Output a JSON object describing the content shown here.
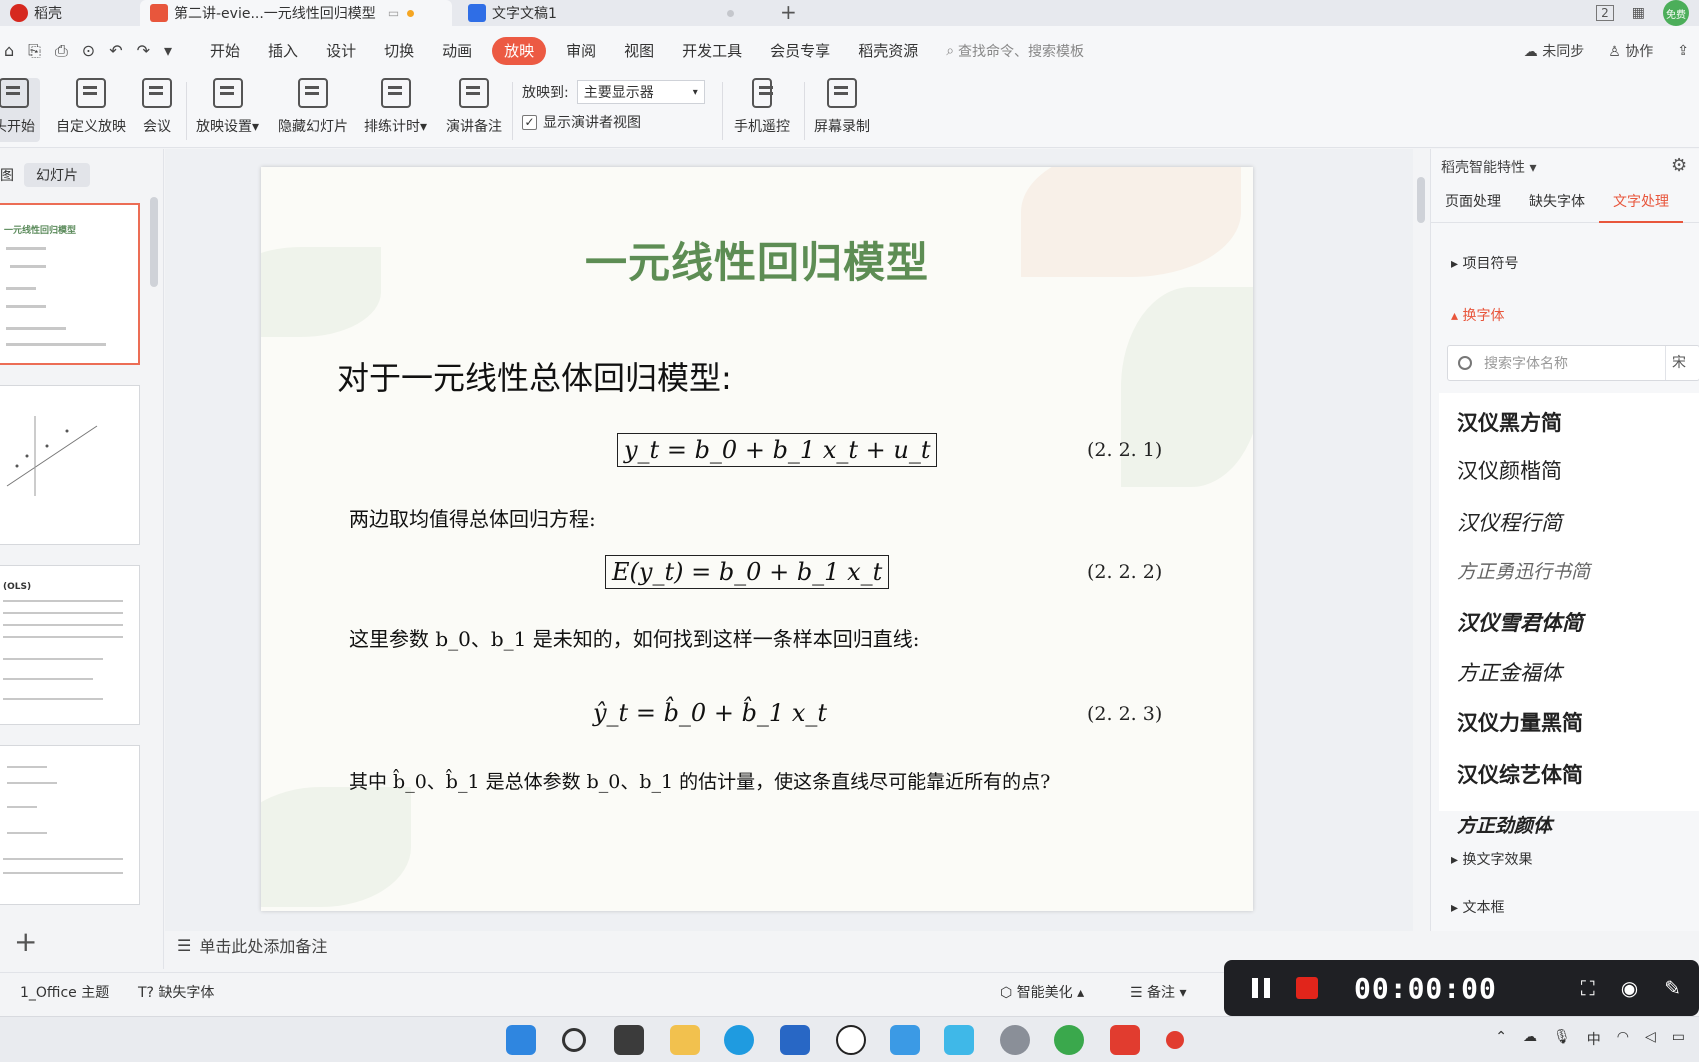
{
  "titlebar": {
    "home_tab": "稻壳",
    "active_tab": "第二讲-evie...一元线性回归模型",
    "doc_tab": "文字文稿1",
    "add": "+",
    "page_indicator": "2",
    "avatar": "免费"
  },
  "menu": {
    "items": [
      "开始",
      "插入",
      "设计",
      "切换",
      "动画",
      "放映",
      "审阅",
      "视图",
      "开发工具",
      "会员专享",
      "稻壳资源"
    ],
    "active": "放映",
    "search_placeholder": "查找命令、搜索模板",
    "sync": "未同步",
    "collab": "协作"
  },
  "ribbon": {
    "start": "从头开始",
    "custom": "自定义放映",
    "meeting": "会议",
    "settings": "放映设置",
    "hide": "隐藏幻灯片",
    "rehearse": "排练计时",
    "notes": "演讲备注",
    "cast_label": "放映到:",
    "cast_value": "主要显示器",
    "presenter_view": "显示演讲者视图",
    "remote": "手机遥控",
    "record": "屏幕录制"
  },
  "left": {
    "tab_outline": "图",
    "tab_slides": "幻灯片",
    "thumb1_title": "一元线性回归模型",
    "thumb3_title": "(OLS)"
  },
  "slide": {
    "title": "一元线性回归模型",
    "subtitle": "对于一元线性总体回归模型:",
    "eq1": "y_t = b_0 + b_1 x_t + u_t",
    "eq1_num": "(2. 2. 1)",
    "line2": "两边取均值得总体回归方程:",
    "eq2": "E(y_t) = b_0 + b_1 x_t",
    "eq2_num": "(2. 2. 2)",
    "line3": "这里参数 b_0、b_1 是未知的，如何找到这样一条样本回归直线:",
    "eq3": "ŷ_t = b̂_0 + b̂_1 x_t",
    "eq3_num": "(2. 2. 3)",
    "line4": "其中 b̂_0、b̂_1 是总体参数 b_0、b_1 的估计量，使这条直线尽可能靠近所有的点?"
  },
  "notes": "单击此处添加备注",
  "right": {
    "header": "稻壳智能特性",
    "tabs": [
      "页面处理",
      "缺失字体",
      "文字处理"
    ],
    "active_tab": "文字处理",
    "sec1": "项目符号",
    "sec2": "换字体",
    "search_placeholder": "搜索字体名称",
    "search_tail": "宋",
    "fonts": [
      "汉仪黑方简",
      "汉仪颜楷简",
      "汉仪程行简",
      "方正勇迅行书简",
      "汉仪雪君体简",
      "方正金福体",
      "汉仪力量黑简",
      "汉仪综艺体简",
      "方正劲颜体"
    ],
    "sec3": "换文字效果",
    "sec4": "文本框"
  },
  "status": {
    "theme": "1_Office 主题",
    "missing_font": "缺失字体",
    "beautify": "智能美化",
    "notes": "备注"
  },
  "recorder": {
    "time": "00:00:00"
  },
  "tray": {
    "ime": "中"
  }
}
